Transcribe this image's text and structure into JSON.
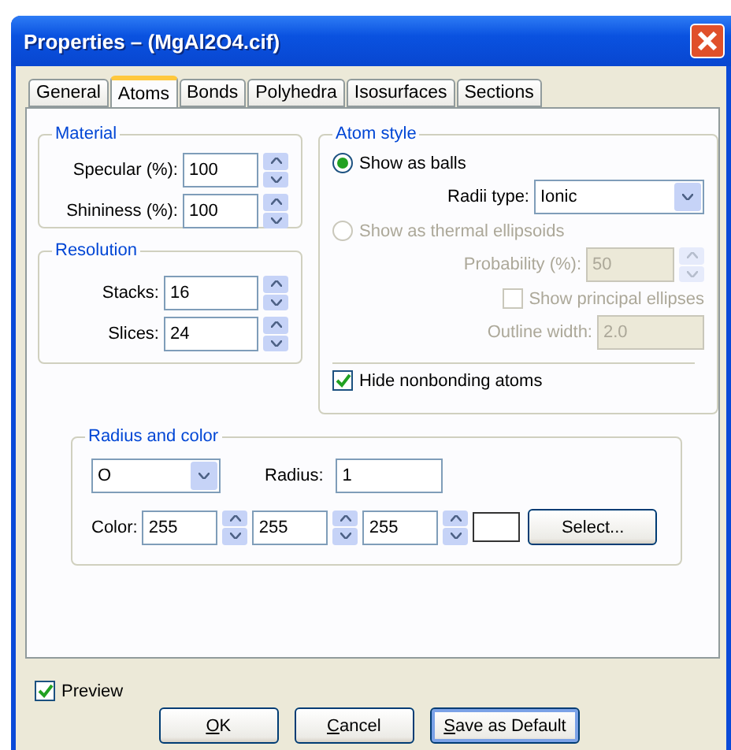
{
  "window": {
    "title": "Properties – (MgAl2O4.cif)"
  },
  "tabs": [
    {
      "label": "General",
      "selected": false
    },
    {
      "label": "Atoms",
      "selected": true
    },
    {
      "label": "Bonds",
      "selected": false
    },
    {
      "label": "Polyhedra",
      "selected": false
    },
    {
      "label": "Isosurfaces",
      "selected": false
    },
    {
      "label": "Sections",
      "selected": false
    }
  ],
  "material": {
    "title": "Material",
    "fields": [
      {
        "label": "Specular (%):",
        "value": "100"
      },
      {
        "label": "Shininess (%):",
        "value": "100"
      }
    ]
  },
  "resolution": {
    "title": "Resolution",
    "fields": [
      {
        "label": "Stacks:",
        "value": "16"
      },
      {
        "label": "Slices:",
        "value": "24"
      }
    ]
  },
  "atom_style": {
    "title": "Atom style",
    "options": [
      {
        "label": "Show as balls",
        "selected": true,
        "disabled": false
      },
      {
        "label": "Show as thermal ellipsoids",
        "selected": false,
        "disabled": true
      }
    ],
    "radii_type": {
      "label": "Radii type:",
      "value": "Ionic"
    },
    "probability": {
      "label": "Probability (%):",
      "value": "50",
      "disabled": true
    },
    "principal_ellipses": {
      "label": "Show principal ellipses",
      "checked": false,
      "disabled": true
    },
    "outline_width": {
      "label": "Outline width:",
      "value": "2.0",
      "disabled": true
    },
    "hide_nonbonding": {
      "label": "Hide nonbonding atoms",
      "checked": true
    }
  },
  "radius_color": {
    "title": "Radius and color",
    "element": "O",
    "radius": {
      "label": "Radius:",
      "value": "1"
    },
    "color": {
      "label": "Color:",
      "values": [
        "255",
        "255",
        "255"
      ]
    },
    "select_button": "Select..."
  },
  "preview": {
    "label": "Preview",
    "checked": true
  },
  "buttons": [
    {
      "key": "O",
      "rest": "K",
      "focused": false
    },
    {
      "key": "C",
      "rest": "ancel",
      "focused": false
    },
    {
      "key": "S",
      "rest": "ave as Default",
      "focused": true
    }
  ]
}
